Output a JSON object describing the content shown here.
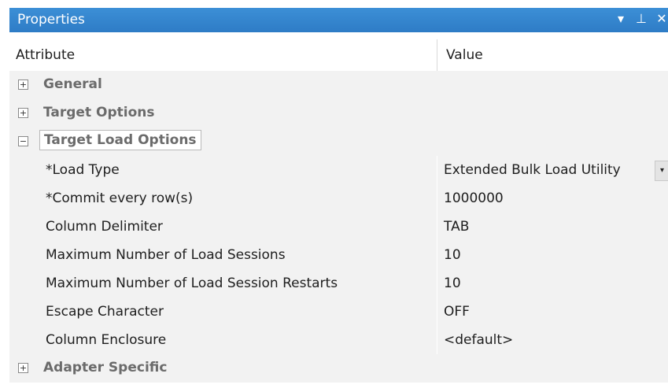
{
  "panel": {
    "title": "Properties",
    "buttons": {
      "dropdown_glyph": "▾",
      "pin_glyph": "⊥",
      "close_glyph": "✕"
    }
  },
  "header": {
    "attribute_label": "Attribute",
    "value_label": "Value"
  },
  "categories": {
    "general": {
      "label": "General",
      "toggle": "+"
    },
    "target_options": {
      "label": "Target Options",
      "toggle": "+"
    },
    "target_load_options": {
      "label": "Target Load Options",
      "toggle": "−"
    },
    "adapter_specific": {
      "label": "Adapter Specific",
      "toggle": "+"
    }
  },
  "properties": [
    {
      "name": "*Load Type",
      "value": "Extended Bulk Load Utility"
    },
    {
      "name": "*Commit every row(s)",
      "value": "1000000"
    },
    {
      "name": "Column Delimiter",
      "value": "TAB"
    },
    {
      "name": "Maximum Number of Load Sessions",
      "value": "10"
    },
    {
      "name": "Maximum Number of Load Session Restarts",
      "value": "10"
    },
    {
      "name": "Escape Character",
      "value": "OFF"
    },
    {
      "name": "Column Enclosure",
      "value": "<default>"
    }
  ],
  "load_type_dropdown_glyph": "▾"
}
